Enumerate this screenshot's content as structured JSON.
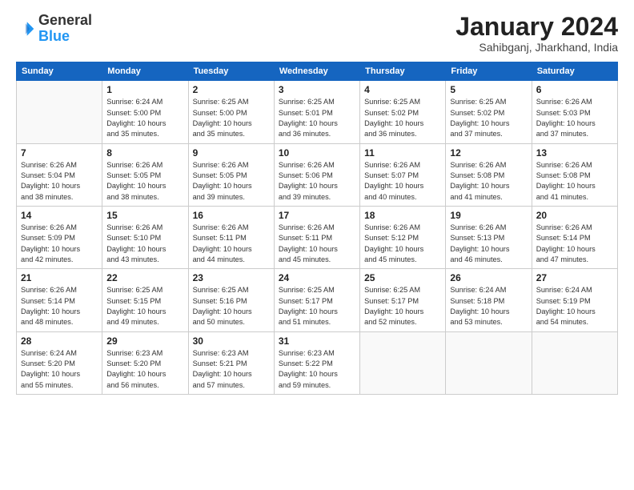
{
  "header": {
    "logo_general": "General",
    "logo_blue": "Blue",
    "month": "January 2024",
    "location": "Sahibganj, Jharkhand, India"
  },
  "days_of_week": [
    "Sunday",
    "Monday",
    "Tuesday",
    "Wednesday",
    "Thursday",
    "Friday",
    "Saturday"
  ],
  "weeks": [
    [
      {
        "num": "",
        "info": ""
      },
      {
        "num": "1",
        "info": "Sunrise: 6:24 AM\nSunset: 5:00 PM\nDaylight: 10 hours\nand 35 minutes."
      },
      {
        "num": "2",
        "info": "Sunrise: 6:25 AM\nSunset: 5:00 PM\nDaylight: 10 hours\nand 35 minutes."
      },
      {
        "num": "3",
        "info": "Sunrise: 6:25 AM\nSunset: 5:01 PM\nDaylight: 10 hours\nand 36 minutes."
      },
      {
        "num": "4",
        "info": "Sunrise: 6:25 AM\nSunset: 5:02 PM\nDaylight: 10 hours\nand 36 minutes."
      },
      {
        "num": "5",
        "info": "Sunrise: 6:25 AM\nSunset: 5:02 PM\nDaylight: 10 hours\nand 37 minutes."
      },
      {
        "num": "6",
        "info": "Sunrise: 6:26 AM\nSunset: 5:03 PM\nDaylight: 10 hours\nand 37 minutes."
      }
    ],
    [
      {
        "num": "7",
        "info": "Sunrise: 6:26 AM\nSunset: 5:04 PM\nDaylight: 10 hours\nand 38 minutes."
      },
      {
        "num": "8",
        "info": "Sunrise: 6:26 AM\nSunset: 5:05 PM\nDaylight: 10 hours\nand 38 minutes."
      },
      {
        "num": "9",
        "info": "Sunrise: 6:26 AM\nSunset: 5:05 PM\nDaylight: 10 hours\nand 39 minutes."
      },
      {
        "num": "10",
        "info": "Sunrise: 6:26 AM\nSunset: 5:06 PM\nDaylight: 10 hours\nand 39 minutes."
      },
      {
        "num": "11",
        "info": "Sunrise: 6:26 AM\nSunset: 5:07 PM\nDaylight: 10 hours\nand 40 minutes."
      },
      {
        "num": "12",
        "info": "Sunrise: 6:26 AM\nSunset: 5:08 PM\nDaylight: 10 hours\nand 41 minutes."
      },
      {
        "num": "13",
        "info": "Sunrise: 6:26 AM\nSunset: 5:08 PM\nDaylight: 10 hours\nand 41 minutes."
      }
    ],
    [
      {
        "num": "14",
        "info": "Sunrise: 6:26 AM\nSunset: 5:09 PM\nDaylight: 10 hours\nand 42 minutes."
      },
      {
        "num": "15",
        "info": "Sunrise: 6:26 AM\nSunset: 5:10 PM\nDaylight: 10 hours\nand 43 minutes."
      },
      {
        "num": "16",
        "info": "Sunrise: 6:26 AM\nSunset: 5:11 PM\nDaylight: 10 hours\nand 44 minutes."
      },
      {
        "num": "17",
        "info": "Sunrise: 6:26 AM\nSunset: 5:11 PM\nDaylight: 10 hours\nand 45 minutes."
      },
      {
        "num": "18",
        "info": "Sunrise: 6:26 AM\nSunset: 5:12 PM\nDaylight: 10 hours\nand 45 minutes."
      },
      {
        "num": "19",
        "info": "Sunrise: 6:26 AM\nSunset: 5:13 PM\nDaylight: 10 hours\nand 46 minutes."
      },
      {
        "num": "20",
        "info": "Sunrise: 6:26 AM\nSunset: 5:14 PM\nDaylight: 10 hours\nand 47 minutes."
      }
    ],
    [
      {
        "num": "21",
        "info": "Sunrise: 6:26 AM\nSunset: 5:14 PM\nDaylight: 10 hours\nand 48 minutes."
      },
      {
        "num": "22",
        "info": "Sunrise: 6:25 AM\nSunset: 5:15 PM\nDaylight: 10 hours\nand 49 minutes."
      },
      {
        "num": "23",
        "info": "Sunrise: 6:25 AM\nSunset: 5:16 PM\nDaylight: 10 hours\nand 50 minutes."
      },
      {
        "num": "24",
        "info": "Sunrise: 6:25 AM\nSunset: 5:17 PM\nDaylight: 10 hours\nand 51 minutes."
      },
      {
        "num": "25",
        "info": "Sunrise: 6:25 AM\nSunset: 5:17 PM\nDaylight: 10 hours\nand 52 minutes."
      },
      {
        "num": "26",
        "info": "Sunrise: 6:24 AM\nSunset: 5:18 PM\nDaylight: 10 hours\nand 53 minutes."
      },
      {
        "num": "27",
        "info": "Sunrise: 6:24 AM\nSunset: 5:19 PM\nDaylight: 10 hours\nand 54 minutes."
      }
    ],
    [
      {
        "num": "28",
        "info": "Sunrise: 6:24 AM\nSunset: 5:20 PM\nDaylight: 10 hours\nand 55 minutes."
      },
      {
        "num": "29",
        "info": "Sunrise: 6:23 AM\nSunset: 5:20 PM\nDaylight: 10 hours\nand 56 minutes."
      },
      {
        "num": "30",
        "info": "Sunrise: 6:23 AM\nSunset: 5:21 PM\nDaylight: 10 hours\nand 57 minutes."
      },
      {
        "num": "31",
        "info": "Sunrise: 6:23 AM\nSunset: 5:22 PM\nDaylight: 10 hours\nand 59 minutes."
      },
      {
        "num": "",
        "info": ""
      },
      {
        "num": "",
        "info": ""
      },
      {
        "num": "",
        "info": ""
      }
    ]
  ]
}
